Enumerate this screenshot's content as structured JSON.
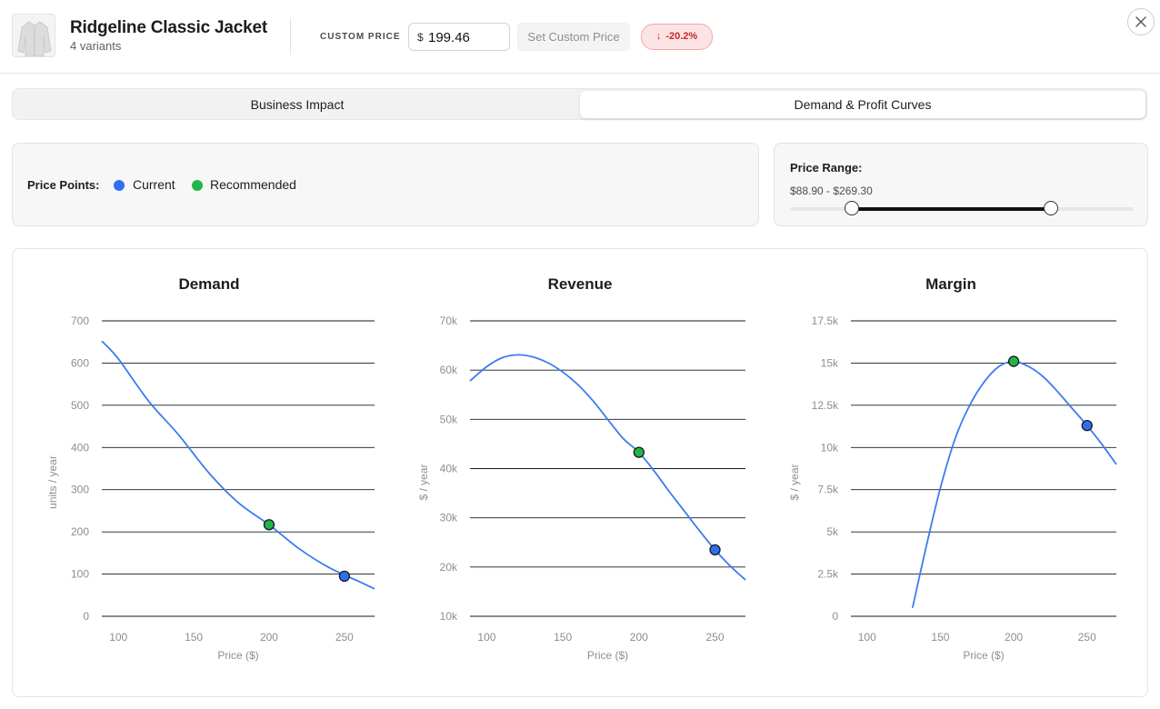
{
  "product": {
    "title": "Ridgeline Classic Jacket",
    "variants": "4 variants",
    "thumbnail_icon": "jacket-image"
  },
  "pricing": {
    "custom_price_label": "CUSTOM PRICE",
    "currency_symbol": "$",
    "custom_price_value": "199.46",
    "set_button_label": "Set Custom Price",
    "change_badge": "-20.2%",
    "change_direction": "down"
  },
  "tabs": [
    {
      "label": "Business Impact",
      "active": false
    },
    {
      "label": "Demand & Profit Curves",
      "active": true
    }
  ],
  "legend": {
    "label": "Price Points:",
    "items": [
      {
        "label": "Current",
        "color": "#2f6ff0"
      },
      {
        "label": "Recommended",
        "color": "#20b64a"
      }
    ]
  },
  "price_range": {
    "title": "Price Range:",
    "value_text": "$88.90 - $269.30",
    "min": 88.9,
    "max": 269.3,
    "slider_low_fraction": 0.18,
    "slider_high_fraction": 0.76
  },
  "colors": {
    "curve": "#3b7cf0",
    "current": "#2f6ff0",
    "recommended": "#20b64a",
    "badge_bg": "#fde4e4",
    "badge_text": "#c62828"
  },
  "chart_data": [
    {
      "type": "line",
      "title": "Demand",
      "xlabel": "Price ($)",
      "ylabel": "units / year",
      "xlim": [
        89,
        270
      ],
      "ylim": [
        0,
        700
      ],
      "xticks": [
        100,
        150,
        200,
        250
      ],
      "yticks": [
        0,
        100,
        200,
        300,
        400,
        500,
        600,
        700
      ],
      "ytick_labels": [
        "0",
        "100",
        "200",
        "300",
        "400",
        "500",
        "600",
        "700"
      ],
      "grid": true,
      "x": [
        89,
        100,
        120,
        140,
        160,
        180,
        200,
        220,
        240,
        260,
        270
      ],
      "y": [
        652,
        610,
        510,
        430,
        340,
        268,
        217,
        160,
        115,
        82,
        65
      ],
      "points": {
        "recommended": {
          "x": 200,
          "y": 217
        },
        "current": {
          "x": 250,
          "y": 95
        }
      }
    },
    {
      "type": "line",
      "title": "Revenue",
      "xlabel": "Price ($)",
      "ylabel": "$ / year",
      "xlim": [
        89,
        270
      ],
      "ylim": [
        10000,
        70000
      ],
      "xticks": [
        100,
        150,
        200,
        250
      ],
      "yticks": [
        10000,
        20000,
        30000,
        40000,
        50000,
        60000,
        70000
      ],
      "ytick_labels": [
        "10k",
        "20k",
        "30k",
        "40k",
        "50k",
        "60k",
        "70k"
      ],
      "grid": true,
      "x": [
        89,
        100,
        110,
        120,
        130,
        140,
        150,
        160,
        170,
        180,
        190,
        200,
        210,
        220,
        230,
        240,
        250,
        260,
        270
      ],
      "y": [
        57800,
        60700,
        62500,
        63100,
        62700,
        61500,
        59600,
        57000,
        53700,
        49800,
        46000,
        43300,
        39500,
        35300,
        31300,
        27300,
        23500,
        20200,
        17400
      ],
      "points": {
        "recommended": {
          "x": 200,
          "y": 43300
        },
        "current": {
          "x": 250,
          "y": 23500
        }
      }
    },
    {
      "type": "line",
      "title": "Margin",
      "xlabel": "Price ($)",
      "ylabel": "$ / year",
      "xlim": [
        89,
        270
      ],
      "ylim": [
        0,
        17500
      ],
      "xticks": [
        100,
        150,
        200,
        250
      ],
      "yticks": [
        0,
        2500,
        5000,
        7500,
        10000,
        12500,
        15000,
        17500
      ],
      "ytick_labels": [
        "0",
        "2.5k",
        "5k",
        "7.5k",
        "10k",
        "12.5k",
        "15k",
        "17.5k"
      ],
      "grid": true,
      "x": [
        131,
        140,
        150,
        160,
        170,
        180,
        190,
        200,
        210,
        220,
        230,
        240,
        250,
        260,
        270
      ],
      "y": [
        500,
        4000,
        7600,
        10500,
        12500,
        13900,
        14800,
        15100,
        14800,
        14200,
        13300,
        12300,
        11300,
        10200,
        9000
      ],
      "points": {
        "recommended": {
          "x": 200,
          "y": 15100
        },
        "current": {
          "x": 250,
          "y": 11300
        }
      }
    }
  ]
}
